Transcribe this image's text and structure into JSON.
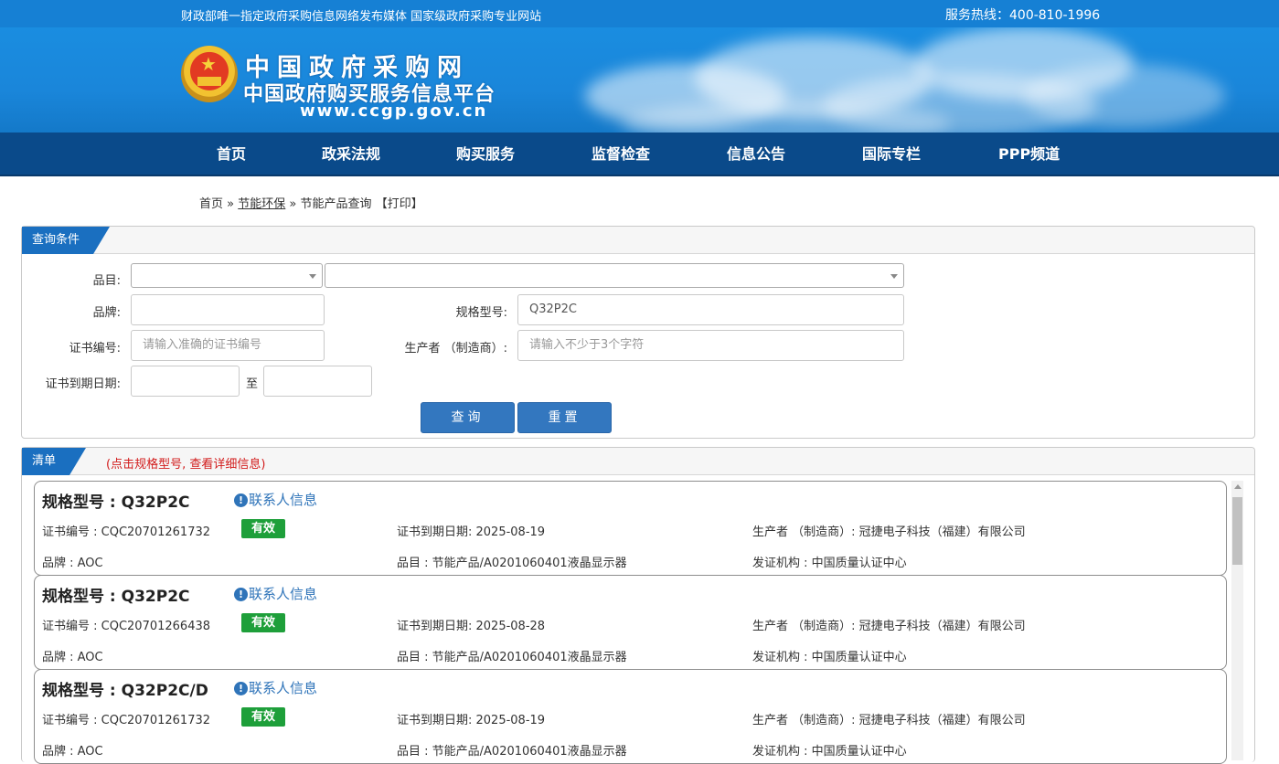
{
  "topbar": {
    "slogan": "财政部唯一指定政府采购信息网络发布媒体 国家级政府采购专业网站",
    "hotline": "服务热线：400-810-1996"
  },
  "header": {
    "title": "中国政府采购网",
    "subtitle": "中国政府购买服务信息平台",
    "url": "www.ccgp.gov.cn"
  },
  "nav": [
    "首页",
    "政采法规",
    "购买服务",
    "监督检查",
    "信息公告",
    "国际专栏",
    "PPP频道"
  ],
  "breadcrumb": {
    "home": "首页",
    "sep1": "»",
    "section": "节能环保",
    "sep2": "»",
    "current": "节能产品查询",
    "print": "【打印】"
  },
  "query": {
    "panel_title": "查询条件",
    "category_label": "品目:",
    "brand_label": "品牌:",
    "brand_value": "",
    "model_label": "规格型号:",
    "model_value": "Q32P2C",
    "cert_label": "证书编号:",
    "cert_placeholder": "请输入准确的证书编号",
    "maker_label": "生产者 （制造商）:",
    "maker_placeholder": "请输入不少于3个字符",
    "expiry_label": "证书到期日期:",
    "expiry_to": "至",
    "search_btn": "查询",
    "reset_btn": "重置"
  },
  "list": {
    "panel_title": "清单",
    "hint": "(点击规格型号, 查看详细信息)",
    "contact_label": "联系人信息",
    "items": [
      {
        "model": "规格型号 : Q32P2C",
        "cert": "证书编号 : CQC20701261732",
        "status": "有效",
        "expiry": "证书到期日期: 2025-08-19",
        "maker": "生产者 （制造商）: 冠捷电子科技（福建）有限公司",
        "brand": "品牌 : AOC",
        "category": "品目 : 节能产品/A0201060401液晶显示器",
        "issuer": "发证机构 : 中国质量认证中心"
      },
      {
        "model": "规格型号 : Q32P2C",
        "cert": "证书编号 : CQC20701266438",
        "status": "有效",
        "expiry": "证书到期日期: 2025-08-28",
        "maker": "生产者 （制造商）: 冠捷电子科技（福建）有限公司",
        "brand": "品牌 : AOC",
        "category": "品目 : 节能产品/A0201060401液晶显示器",
        "issuer": "发证机构 : 中国质量认证中心"
      },
      {
        "model": "规格型号 : Q32P2C/D",
        "cert": "证书编号 : CQC20701261732",
        "status": "有效",
        "expiry": "证书到期日期: 2025-08-19",
        "maker": "生产者 （制造商）: 冠捷电子科技（福建）有限公司",
        "brand": "品牌 : AOC",
        "category": "品目 : 节能产品/A0201060401液晶显示器",
        "issuer": "发证机构 : 中国质量认证中心"
      }
    ]
  },
  "colors": {
    "topbar": "#1680d4",
    "nav": "#0a4a8a",
    "tab": "#1a6fc0",
    "button": "#3377bf",
    "valid_badge": "#1e9f3a",
    "hint": "#d21b1b",
    "link": "#2f74b9"
  }
}
